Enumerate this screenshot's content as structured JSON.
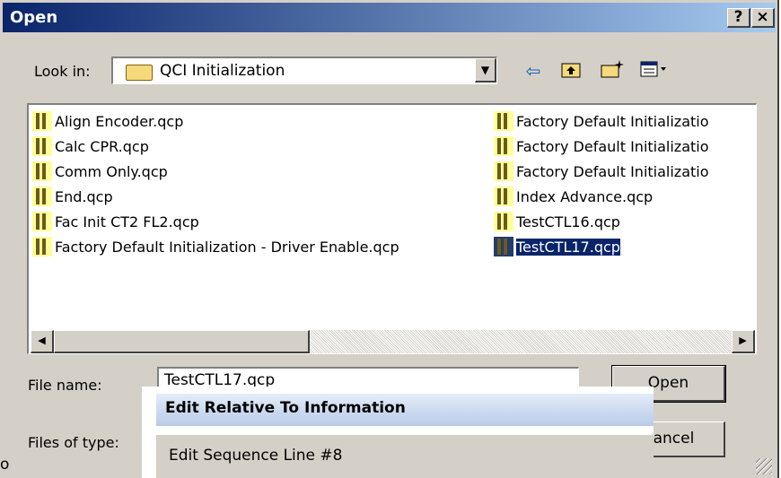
{
  "window": {
    "title": "Open",
    "help_button": "?",
    "close_button": "×"
  },
  "look_in": {
    "label": "Look in:",
    "value": "QCI Initialization"
  },
  "toolbar": {
    "back_icon": "arrow-left-icon",
    "up_icon": "up-folder-icon",
    "new_folder_icon": "new-folder-icon",
    "view_icon": "view-menu-icon"
  },
  "files_left": [
    {
      "name": "Align Encoder.qcp"
    },
    {
      "name": "Calc CPR.qcp"
    },
    {
      "name": "Comm Only.qcp"
    },
    {
      "name": "End.qcp"
    },
    {
      "name": "Fac Init CT2 FL2.qcp"
    },
    {
      "name": "Factory Default Initialization - Driver Enable.qcp"
    }
  ],
  "files_right": [
    {
      "name": "Factory Default Initializatio"
    },
    {
      "name": "Factory Default Initializatio"
    },
    {
      "name": "Factory Default Initializatio"
    },
    {
      "name": "Index Advance.qcp"
    },
    {
      "name": "TestCTL16.qcp"
    },
    {
      "name": "TestCTL17.qcp",
      "selected": true
    }
  ],
  "file_name": {
    "label": "File name:",
    "value": "TestCTL17.qcp"
  },
  "files_of_type": {
    "label": "Files of type:"
  },
  "buttons": {
    "open": "Open",
    "cancel": "Cancel"
  },
  "popup": {
    "header": "Edit Relative To Information",
    "item": "Edit Sequence Line #8"
  },
  "stray_char": "o"
}
